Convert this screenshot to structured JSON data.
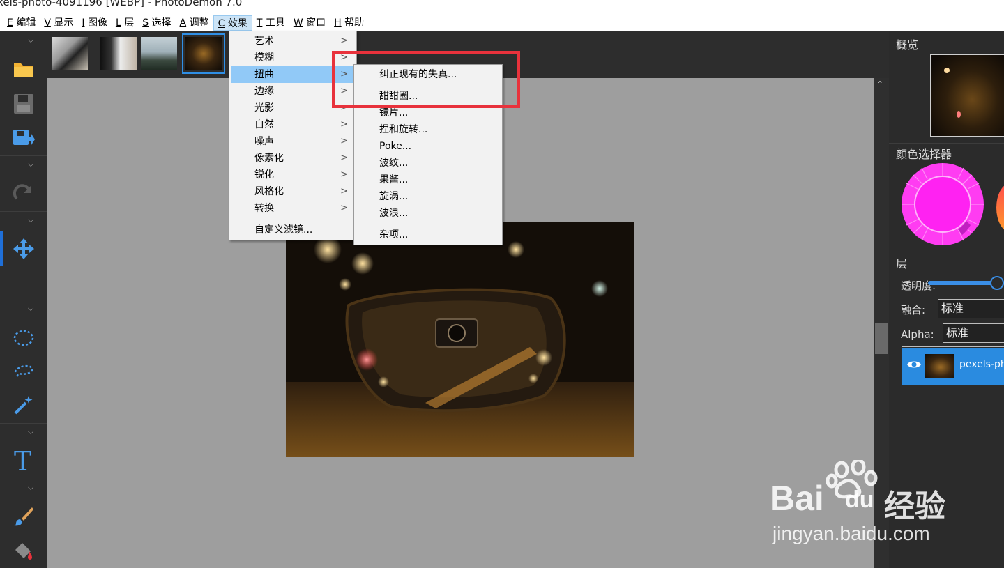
{
  "window": {
    "title": "xels-photo-4091196 [WEBP]  -  PhotoDemon 7.0"
  },
  "menubar": [
    {
      "key": "E",
      "label": "编辑"
    },
    {
      "key": "V",
      "label": "显示"
    },
    {
      "key": "I",
      "label": "图像"
    },
    {
      "key": "L",
      "label": "层"
    },
    {
      "key": "S",
      "label": "选择"
    },
    {
      "key": "A",
      "label": "调整"
    },
    {
      "key": "C",
      "label": "效果",
      "active": true
    },
    {
      "key": "T",
      "label": "工具"
    },
    {
      "key": "W",
      "label": "窗口"
    },
    {
      "key": "H",
      "label": "帮助"
    }
  ],
  "effects_menu": {
    "items": [
      "艺术",
      "模糊",
      "扭曲",
      "边缘",
      "光影",
      "自然",
      "噪声",
      "像素化",
      "锐化",
      "风格化",
      "转换"
    ],
    "highlighted": "扭曲",
    "custom": "自定义滤镜..."
  },
  "distort_submenu": {
    "items": [
      "纠正现有的失真...",
      "甜甜圈...",
      "镜片...",
      "捏和旋转...",
      "Poke...",
      "波纹...",
      "果酱...",
      "旋涡...",
      "波浪..."
    ],
    "misc": "杂项..."
  },
  "right_panel": {
    "overview_title": "概览",
    "color_picker_title": "颜色选择器",
    "layers_title": "层",
    "opacity_label": "透明度:",
    "opacity_value": 0.95,
    "blend_label": "融合:",
    "blend_value": "标准",
    "alpha_label": "Alpha:",
    "alpha_value": "标准",
    "layer_name": "pexels-ph",
    "primary_color": "#ff2cf6"
  },
  "left_toolbar": {
    "tools": [
      "open-folder-icon",
      "save-icon",
      "save-as-icon",
      "redo-icon",
      "move-icon",
      "ellipse-select-icon",
      "lasso-select-icon",
      "magic-wand-icon",
      "text-icon",
      "brush-icon",
      "fill-bucket-icon"
    ],
    "accent": "#4a9be8"
  },
  "thumbnails": {
    "count": 4,
    "selected_index": 3
  },
  "watermark": {
    "brand": "Bai",
    "brand2": "du",
    "brand_cn": "经验",
    "url": "jingyan.baidu.com"
  }
}
